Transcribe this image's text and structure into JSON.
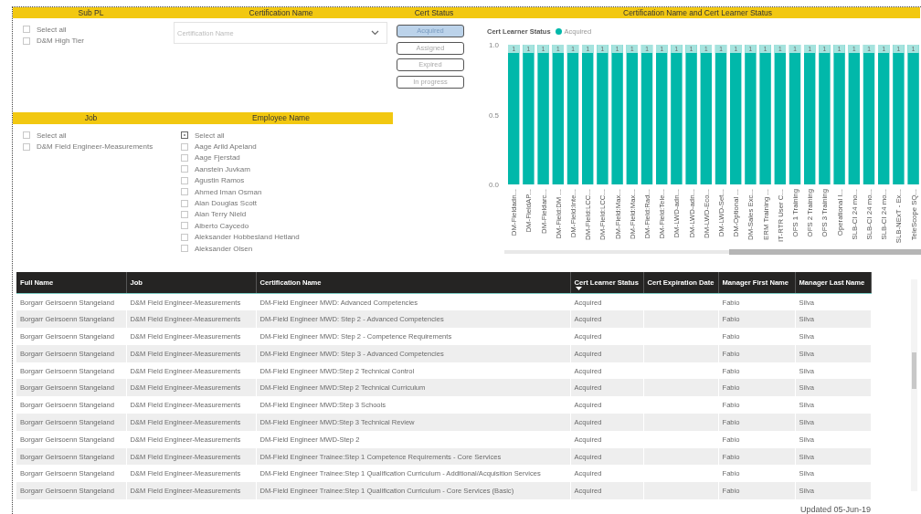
{
  "slicers": [
    {
      "kind": "checklist",
      "title": "Sub PL",
      "items": [
        {
          "label": "Select all",
          "checked": false
        },
        {
          "label": "D&M High Tier",
          "checked": false
        }
      ]
    },
    {
      "kind": "dropdown",
      "title": "Certification Name",
      "placeholder": "Certification Name"
    },
    {
      "kind": "buttons",
      "title": "Cert Status",
      "items": [
        {
          "label": "Acquired",
          "selected": true
        },
        {
          "label": "Assigned",
          "selected": false
        },
        {
          "label": "Expired",
          "selected": false
        },
        {
          "label": "In progress",
          "selected": false
        }
      ]
    },
    {
      "kind": "checklist",
      "title": "Job",
      "items": [
        {
          "label": "Select all",
          "checked": false
        },
        {
          "label": "D&M Field Engineer-Measurements",
          "checked": false
        }
      ]
    },
    {
      "kind": "checklist",
      "title": "Employee Name",
      "items": [
        {
          "label": "Select all",
          "checked": true
        },
        {
          "label": "Aage Arild Apeland",
          "checked": false
        },
        {
          "label": "Aage Fjerstad",
          "checked": false
        },
        {
          "label": "Aanstein Juvkam",
          "checked": false
        },
        {
          "label": "Agustin Ramos",
          "checked": false
        },
        {
          "label": "Ahmed Iman Osman",
          "checked": false
        },
        {
          "label": "Alan Douglas Scott",
          "checked": false
        },
        {
          "label": "Alan Terry Nield",
          "checked": false
        },
        {
          "label": "Alberto Caycedo",
          "checked": false
        },
        {
          "label": "Aleksander Hobbesland Hetland",
          "checked": false
        },
        {
          "label": "Aleksander Olsen",
          "checked": false
        }
      ]
    }
  ],
  "chart": {
    "legend_title": "Cert Learner Status",
    "chart_data": {
      "type": "bar",
      "title": "Certification Name and Cert Learner Status",
      "categories": [
        "DM-Fieldadn...",
        "DM-FieldAP...",
        "DM-Fieldarc...",
        "DM-Field:DM ...",
        "DM-Field:Inte...",
        "DM-Field:LCC...",
        "DM-Field:LCC...",
        "DM-Field:Max...",
        "DM-Field:Max...",
        "DM-Field:Rad...",
        "DM-Field:Tele...",
        "DM-LWD-adn...",
        "DM-LWD-adn...",
        "DM-LWD-Eco...",
        "DM-LWD-Set...",
        "DM-Optional ...",
        "DM-Sales Exc...",
        "ERM Training ...",
        "IT-RTR User C...",
        "OFS 1 Training",
        "OFS 2 Training",
        "OFS 3 Training",
        "Operational I...",
        "SLB-CI 24 mo...",
        "SLB-CI 24 mo...",
        "SLB-CI 24 mo...",
        "SLB-NExT - Ex...",
        "TeleScope SQ..."
      ],
      "series": [
        {
          "name": "Acquired",
          "color": "#01b8aa",
          "values": [
            1,
            1,
            1,
            1,
            1,
            1,
            1,
            1,
            1,
            1,
            1,
            1,
            1,
            1,
            1,
            1,
            1,
            1,
            1,
            1,
            1,
            1,
            1,
            1,
            1,
            1,
            1,
            1
          ]
        }
      ],
      "ylim": [
        0,
        1
      ],
      "yticks": [
        {
          "value": 0,
          "label": "0.0"
        },
        {
          "value": 0.5,
          "label": "0.5"
        },
        {
          "value": 1,
          "label": "1.0"
        }
      ],
      "data_labels": true
    }
  },
  "table": {
    "columns": [
      {
        "label": "Full Name",
        "sorted": false
      },
      {
        "label": "Job",
        "sorted": false
      },
      {
        "label": "Certification Name",
        "sorted": false
      },
      {
        "label": "Cert Learner Status",
        "sorted": true
      },
      {
        "label": "Cert Expiration Date",
        "sorted": false
      },
      {
        "label": "Manager First Name",
        "sorted": false
      },
      {
        "label": "Manager Last Name",
        "sorted": false
      }
    ],
    "rows": [
      [
        "Borgarr Geirsoenn Stangeland",
        "D&M Field Engineer-Measurements",
        "DM-Field Engineer MWD: Advanced Competencies",
        "Acquired",
        "",
        "Fabio",
        "Silva"
      ],
      [
        "Borgarr Geirsoenn Stangeland",
        "D&M Field Engineer-Measurements",
        "DM-Field Engineer MWD: Step 2 - Advanced Competencies",
        "Acquired",
        "",
        "Fabio",
        "Silva"
      ],
      [
        "Borgarr Geirsoenn Stangeland",
        "D&M Field Engineer-Measurements",
        "DM-Field Engineer MWD: Step 2 - Competence Requirements",
        "Acquired",
        "",
        "Fabio",
        "Silva"
      ],
      [
        "Borgarr Geirsoenn Stangeland",
        "D&M Field Engineer-Measurements",
        "DM-Field Engineer MWD: Step 3 - Advanced Competencies",
        "Acquired",
        "",
        "Fabio",
        "Silva"
      ],
      [
        "Borgarr Geirsoenn Stangeland",
        "D&M Field Engineer-Measurements",
        "DM-Field Engineer MWD:Step 2 Technical Control",
        "Acquired",
        "",
        "Fabio",
        "Silva"
      ],
      [
        "Borgarr Geirsoenn Stangeland",
        "D&M Field Engineer-Measurements",
        "DM-Field Engineer MWD:Step 2 Technical Curriculum",
        "Acquired",
        "",
        "Fabio",
        "Silva"
      ],
      [
        "Borgarr Geirsoenn Stangeland",
        "D&M Field Engineer-Measurements",
        "DM-Field Engineer MWD:Step 3 Schools",
        "Acquired",
        "",
        "Fabio",
        "Silva"
      ],
      [
        "Borgarr Geirsoenn Stangeland",
        "D&M Field Engineer-Measurements",
        "DM-Field Engineer MWD:Step 3 Technical Review",
        "Acquired",
        "",
        "Fabio",
        "Silva"
      ],
      [
        "Borgarr Geirsoenn Stangeland",
        "D&M Field Engineer-Measurements",
        "DM-Field Engineer MWD-Step 2",
        "Acquired",
        "",
        "Fabio",
        "Silva"
      ],
      [
        "Borgarr Geirsoenn Stangeland",
        "D&M Field Engineer-Measurements",
        "DM-Field Engineer Trainee:Step 1 Competence Requirements - Core Services",
        "Acquired",
        "",
        "Fabio",
        "Silva"
      ],
      [
        "Borgarr Geirsoenn Stangeland",
        "D&M Field Engineer-Measurements",
        "DM-Field Engineer Trainee:Step 1 Qualification Curriculum - Additional/Acquisition Services",
        "Acquired",
        "",
        "Fabio",
        "Silva"
      ],
      [
        "Borgarr Geirsoenn Stangeland",
        "D&M Field Engineer-Measurements",
        "DM-Field Engineer Trainee:Step 1 Qualification Curriculum - Core Services (Basic)",
        "Acquired",
        "",
        "Fabio",
        "Silva"
      ]
    ]
  },
  "updated": "Updated 05-Jun-19"
}
